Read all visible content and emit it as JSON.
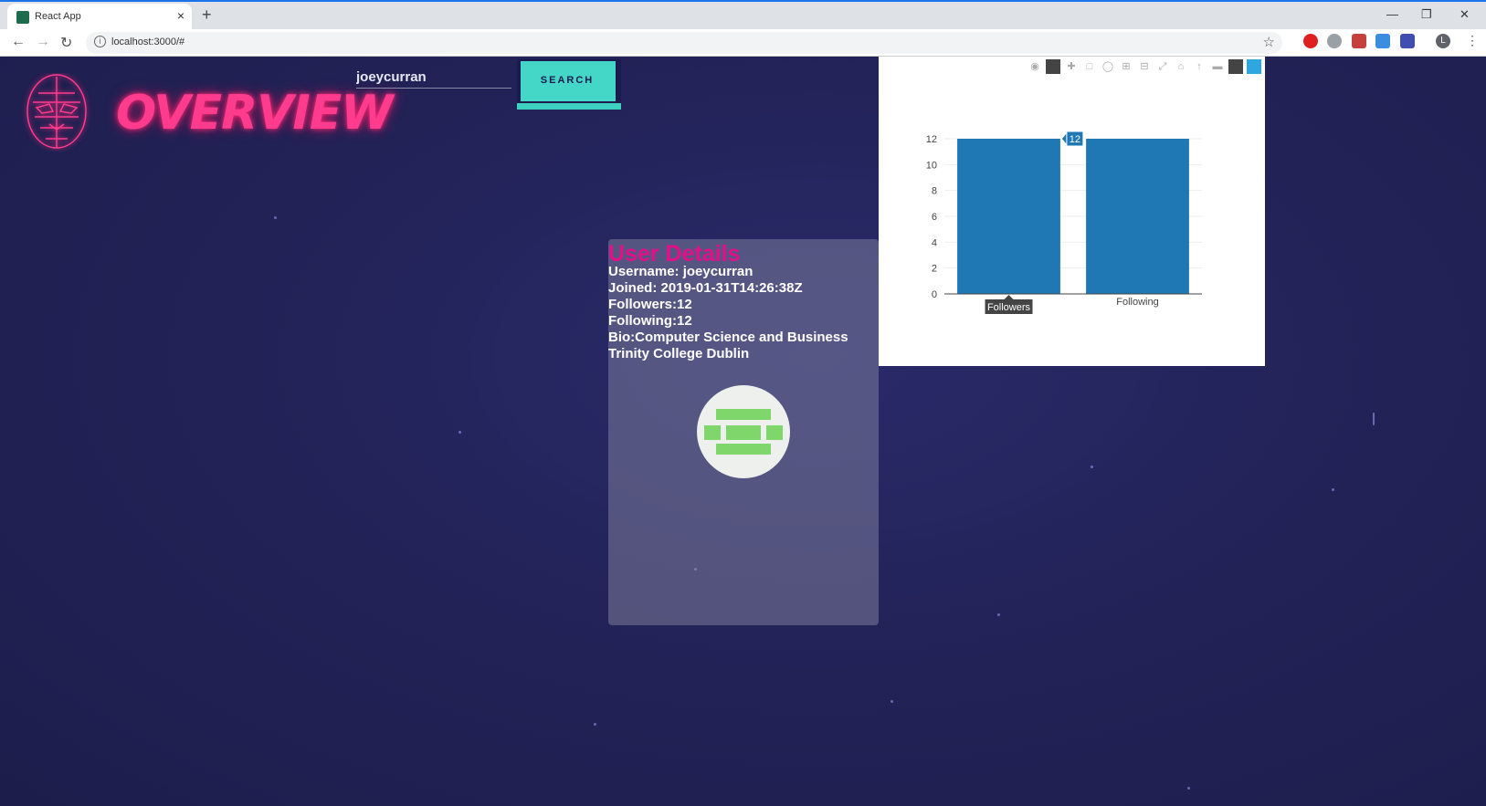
{
  "browser": {
    "tab_title": "React App",
    "url": "localhost:3000/#",
    "new_tab_glyph": "+",
    "close_tab_glyph": "×",
    "profile_initial": "L"
  },
  "app": {
    "logo_text": "OVERVIEW",
    "search": {
      "value": "joeycurran",
      "button_label": "SEARCH"
    },
    "user_card": {
      "title": "User Details",
      "username_line": "Username: joeycurran",
      "joined_line": "Joined: 2019-01-31T14:26:38Z",
      "followers_line": "Followers:12",
      "following_line": "Following:12",
      "bio_line1": "Bio:Computer Science and Business",
      "bio_line2": "Trinity College Dublin"
    },
    "colors": {
      "accent_pink": "#e40f88",
      "button_teal": "#44d6c6",
      "bar_blue": "#1f77b4",
      "avatar_green": "#7fd66a"
    }
  },
  "chart_data": {
    "type": "bar",
    "categories": [
      "Followers",
      "Following"
    ],
    "values": [
      12,
      12
    ],
    "ylim": [
      0,
      12
    ],
    "yticks": [
      0,
      2,
      4,
      6,
      8,
      10,
      12
    ],
    "hover": {
      "category": "Followers",
      "value_label": "12",
      "category_label": "Followers"
    },
    "grid": true,
    "legend": "none"
  }
}
